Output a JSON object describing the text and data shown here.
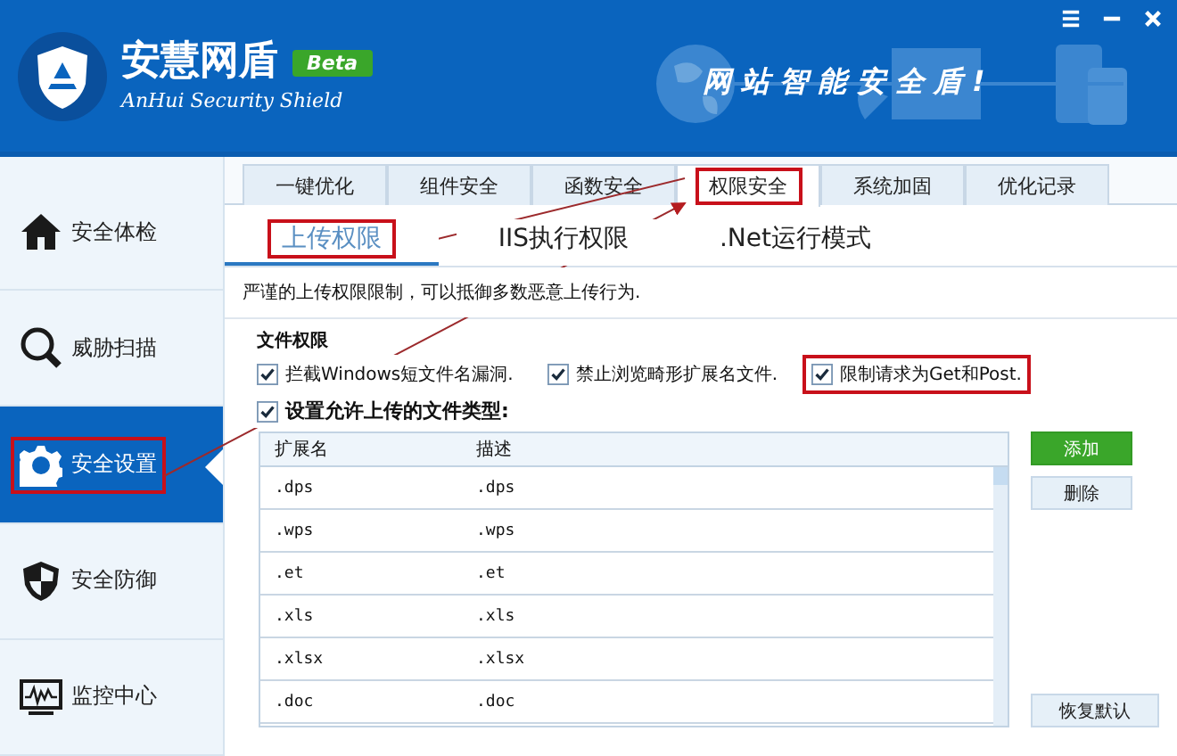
{
  "header": {
    "title": "安慧网盾",
    "badge": "Beta",
    "subtitle": "AnHui Security Shield",
    "slogan": "网 站 智 能 安 全 盾 !"
  },
  "sidebar": {
    "items": [
      {
        "label": "安全体检",
        "selected": false,
        "highlighted": false
      },
      {
        "label": "威胁扫描",
        "selected": false,
        "highlighted": false
      },
      {
        "label": "安全设置",
        "selected": true,
        "highlighted": true
      },
      {
        "label": "安全防御",
        "selected": false,
        "highlighted": false
      },
      {
        "label": "监控中心",
        "selected": false,
        "highlighted": false
      }
    ]
  },
  "tabs": [
    {
      "label": "一键优化",
      "selected": false,
      "highlighted": false
    },
    {
      "label": "组件安全",
      "selected": false,
      "highlighted": false
    },
    {
      "label": "函数安全",
      "selected": false,
      "highlighted": false
    },
    {
      "label": "权限安全",
      "selected": true,
      "highlighted": true
    },
    {
      "label": "系统加固",
      "selected": false,
      "highlighted": false
    },
    {
      "label": "优化记录",
      "selected": false,
      "highlighted": false
    }
  ],
  "subtabs": [
    {
      "label": "上传权限",
      "selected": true,
      "highlighted": true
    },
    {
      "label": "IIS执行权限",
      "selected": false,
      "highlighted": false
    },
    {
      "label": ".Net运行模式",
      "selected": false,
      "highlighted": false
    }
  ],
  "description": "严谨的上传权限限制，可以抵御多数恶意上传行为.",
  "section_title": "文件权限",
  "options": [
    {
      "label": "拦截Windows短文件名漏洞.",
      "checked": true,
      "highlighted": false
    },
    {
      "label": "禁止浏览畸形扩展名文件.",
      "checked": true,
      "highlighted": false
    },
    {
      "label": "限制请求为Get和Post.",
      "checked": true,
      "highlighted": true
    }
  ],
  "file_types": {
    "label": "设置允许上传的文件类型:",
    "checked": true,
    "columns": [
      "扩展名",
      "描述"
    ],
    "rows": [
      [
        ".dps",
        ".dps"
      ],
      [
        ".wps",
        ".wps"
      ],
      [
        ".et",
        ".et"
      ],
      [
        ".xls",
        ".xls"
      ],
      [
        ".xlsx",
        ".xlsx"
      ],
      [
        ".doc",
        ".doc"
      ]
    ]
  },
  "buttons": [
    {
      "label": "添加",
      "kind": "primary"
    },
    {
      "label": "删除",
      "kind": "secondary"
    },
    {
      "label": "恢复默认",
      "kind": "secondary"
    }
  ]
}
